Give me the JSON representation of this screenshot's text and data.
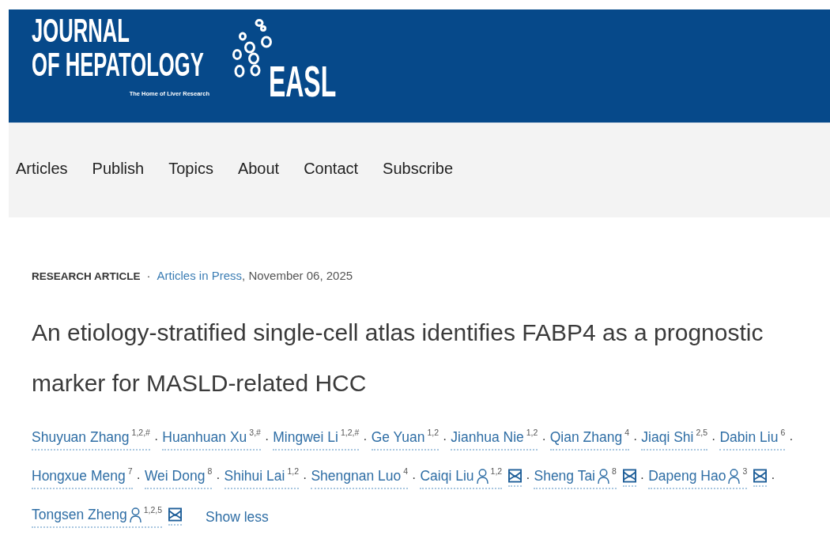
{
  "header": {
    "title_lines": [
      "JOURNAL",
      "OF HEPATOLOGY"
    ],
    "tagline": "The Home of Liver Research",
    "society": "EASL"
  },
  "nav": {
    "items": [
      {
        "label": "Articles"
      },
      {
        "label": "Publish"
      },
      {
        "label": "Topics"
      },
      {
        "label": "About"
      },
      {
        "label": "Contact"
      },
      {
        "label": "Subscribe"
      }
    ]
  },
  "article": {
    "type": "RESEARCH ARTICLE",
    "type_separator": "·",
    "issue": "Articles in Press",
    "date": ", November 06, 2025",
    "title": "An etiology-stratified single-cell atlas identifies FABP4 as a prognostic marker for MASLD-related HCC",
    "authors": [
      {
        "name": "Shuyuan Zhang",
        "affiliations": "1,2,#",
        "corresponding": false,
        "email": false,
        "separator": "·"
      },
      {
        "name": "Huanhuan Xu",
        "affiliations": "3,#",
        "corresponding": false,
        "email": false,
        "separator": "·"
      },
      {
        "name": "Mingwei Li",
        "affiliations": "1,2,#",
        "corresponding": false,
        "email": false,
        "separator": "·"
      },
      {
        "name": "Ge Yuan",
        "affiliations": "1,2",
        "corresponding": false,
        "email": false,
        "separator": "·"
      },
      {
        "name": "Jianhua Nie",
        "affiliations": "1,2",
        "corresponding": false,
        "email": false,
        "separator": "·"
      },
      {
        "name": "Qian Zhang",
        "affiliations": "4",
        "corresponding": false,
        "email": false,
        "separator": "·"
      },
      {
        "name": "Jiaqi Shi",
        "affiliations": "2,5",
        "corresponding": false,
        "email": false,
        "separator": "·"
      },
      {
        "name": "Dabin Liu",
        "affiliations": "6",
        "corresponding": false,
        "email": false,
        "separator": "·"
      },
      {
        "name": "Hongxue Meng",
        "affiliations": "7",
        "corresponding": false,
        "email": false,
        "separator": "·"
      },
      {
        "name": "Wei Dong",
        "affiliations": "8",
        "corresponding": false,
        "email": false,
        "separator": "·"
      },
      {
        "name": "Shihui Lai",
        "affiliations": "1,2",
        "corresponding": false,
        "email": false,
        "separator": "·"
      },
      {
        "name": "Shengnan Luo",
        "affiliations": "4",
        "corresponding": false,
        "email": false,
        "separator": "·"
      },
      {
        "name": "Caiqi Liu",
        "affiliations": "1,2",
        "corresponding": true,
        "email": true,
        "separator": "·"
      },
      {
        "name": "Sheng Tai",
        "affiliations": "8",
        "corresponding": true,
        "email": true,
        "separator": "·"
      },
      {
        "name": "Dapeng Hao",
        "affiliations": "3",
        "corresponding": true,
        "email": true,
        "separator": "·"
      },
      {
        "name": "Tongsen Zheng",
        "affiliations": "1,2,5",
        "corresponding": true,
        "email": true
      }
    ],
    "toggle": "Show less"
  }
}
